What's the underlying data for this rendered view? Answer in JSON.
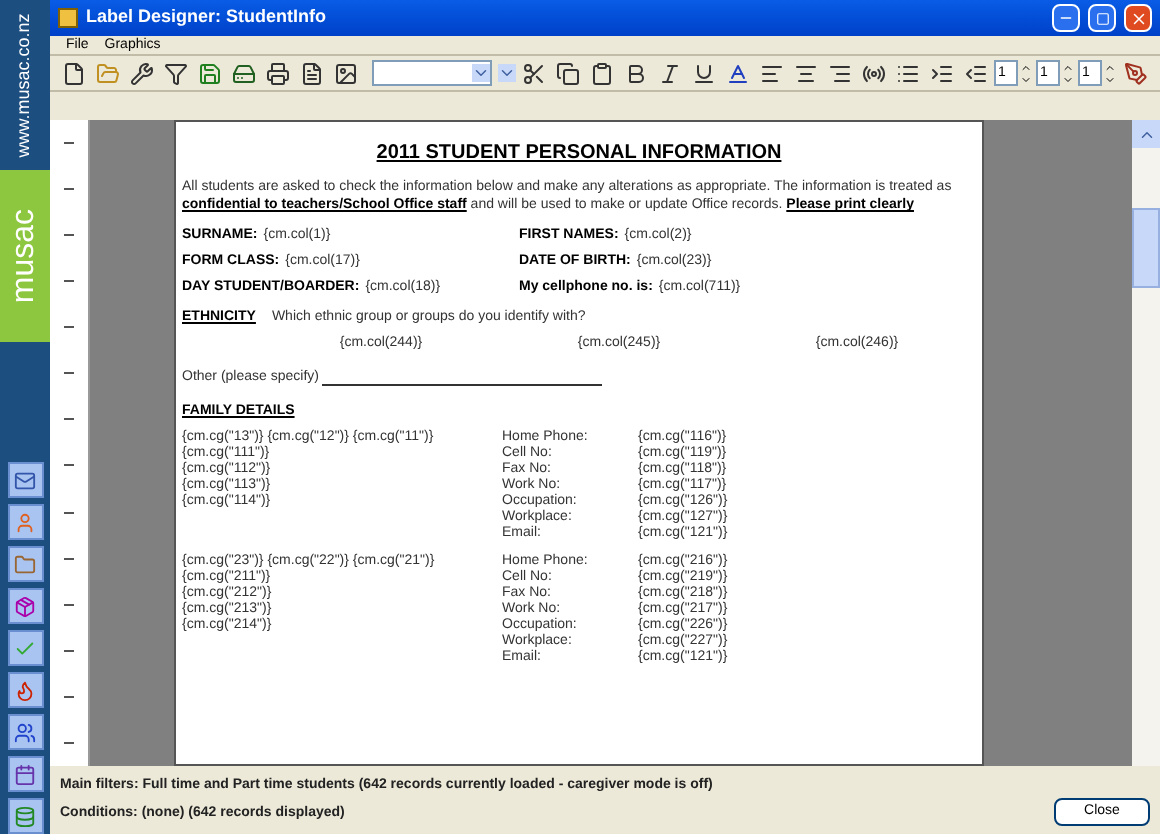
{
  "window": {
    "title": "Label Designer: StudentInfo"
  },
  "brand": {
    "url": "www.musac.co.nz",
    "logo": "musac"
  },
  "menu": [
    "File",
    "Graphics"
  ],
  "toolbar": {
    "spinners": [
      "1",
      "1",
      "1"
    ]
  },
  "document": {
    "heading": "2011 STUDENT PERSONAL INFORMATION",
    "intro": "All students are asked to check the information below and make any alterations as appropriate. The information is treated as **confidential to teachers/School Office staff** and will be used to make or update Office records.  **Please print clearly**",
    "fields": [
      {
        "label": "SURNAME:",
        "value": "{cm.col(1)}"
      },
      {
        "label": "FIRST NAMES:",
        "value": "{cm.col(2)}"
      },
      {
        "label": "FORM CLASS:",
        "value": "{cm.col(17)}"
      },
      {
        "label": "DATE OF BIRTH:",
        "value": "{cm.col(23)}"
      },
      {
        "label": "DAY STUDENT/BOARDER:",
        "value": "{cm.col(18)}"
      },
      {
        "label": "My cellphone no. is:",
        "value": "{cm.col(711)}"
      }
    ],
    "ethnicity": {
      "label": "ETHNICITY",
      "question": "Which ethnic group or groups do you identify with?",
      "options": [
        "{cm.col(244)}",
        "{cm.col(245)}",
        "{cm.col(246)}"
      ]
    },
    "other": {
      "label": "Other (please specify)"
    },
    "family": {
      "heading": "FAMILY DETAILS",
      "caregivers": [
        {
          "names": [
            "{cm.cg(\"13\")} {cm.cg(\"12\")} {cm.cg(\"11\")}",
            "{cm.cg(\"111\")}",
            "{cm.cg(\"112\")}",
            "{cm.cg(\"113\")}",
            "{cm.cg(\"114\")}"
          ],
          "contacts": [
            {
              "label": "Home Phone:",
              "value": "{cm.cg(\"116\")}"
            },
            {
              "label": "Cell No:",
              "value": "{cm.cg(\"119\")}"
            },
            {
              "label": "Fax No:",
              "value": "{cm.cg(\"118\")}"
            },
            {
              "label": "Work No:",
              "value": "{cm.cg(\"117\")}"
            },
            {
              "label": "Occupation:",
              "value": "{cm.cg(\"126\")}"
            },
            {
              "label": "Workplace:",
              "value": "{cm.cg(\"127\")}"
            },
            {
              "label": "Email:",
              "value": "{cm.cg(\"121\")}"
            }
          ]
        },
        {
          "names": [
            "{cm.cg(\"23\")} {cm.cg(\"22\")} {cm.cg(\"21\")}",
            "{cm.cg(\"211\")}",
            "{cm.cg(\"212\")}",
            "{cm.cg(\"213\")}",
            "{cm.cg(\"214\")}"
          ],
          "contacts": [
            {
              "label": "Home Phone:",
              "value": "{cm.cg(\"216\")}"
            },
            {
              "label": "Cell No:",
              "value": "{cm.cg(\"219\")}"
            },
            {
              "label": "Fax No:",
              "value": "{cm.cg(\"218\")}"
            },
            {
              "label": "Work No:",
              "value": "{cm.cg(\"217\")}"
            },
            {
              "label": "Occupation:",
              "value": "{cm.cg(\"226\")}"
            },
            {
              "label": "Workplace:",
              "value": "{cm.cg(\"227\")}"
            },
            {
              "label": "Email:",
              "value": "{cm.cg(\"121\")}"
            }
          ]
        }
      ]
    }
  },
  "status": {
    "lines": [
      "Main filters: Full time and Part time students (642 records currently loaded - caregiver mode is off)",
      "Conditions: (none) (642 records displayed)"
    ],
    "close": "Close"
  }
}
